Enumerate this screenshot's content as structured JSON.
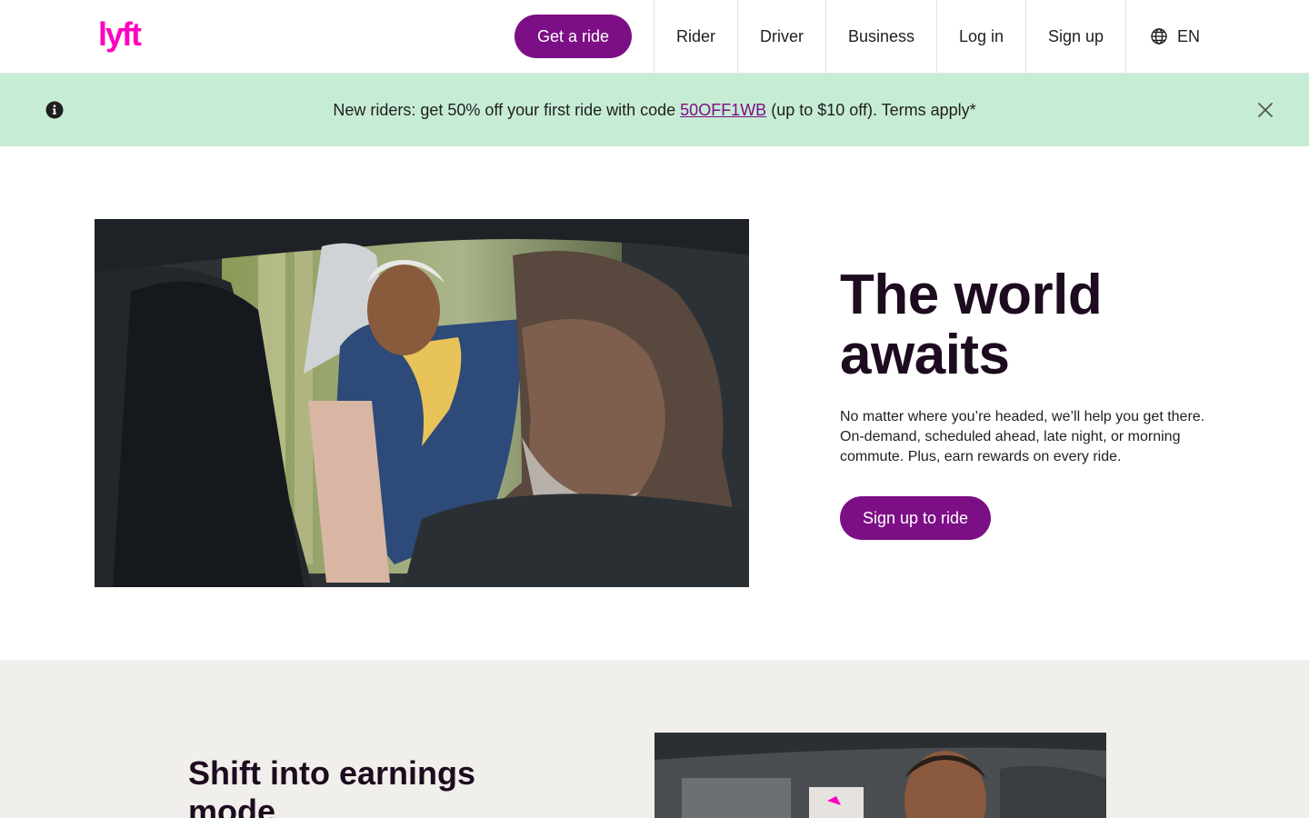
{
  "header": {
    "logo_text": "lyft",
    "get_ride_label": "Get a ride",
    "nav": {
      "rider": "Rider",
      "driver": "Driver",
      "business": "Business",
      "login": "Log in",
      "signup": "Sign up",
      "language": "EN"
    }
  },
  "banner": {
    "text_before": "New riders: get 50% off your first ride with code",
    "code": "50OFF1WB",
    "text_after": "(up to $10 off). Terms apply*"
  },
  "hero": {
    "title": "The world awaits",
    "description": "No matter where you’re headed, we’ll help you get there. On-demand, scheduled ahead, late night, or morning commute. Plus, earn rewards on every ride.",
    "cta_label": "Sign up to ride"
  },
  "section2": {
    "title": "Shift into earnings mode"
  },
  "colors": {
    "brand_purple": "#7d0f86",
    "logo_pink": "#ff00bf",
    "banner_green": "#c7ecd5",
    "heading_dark": "#1d0b1f",
    "section_bg": "#f1efeb"
  }
}
